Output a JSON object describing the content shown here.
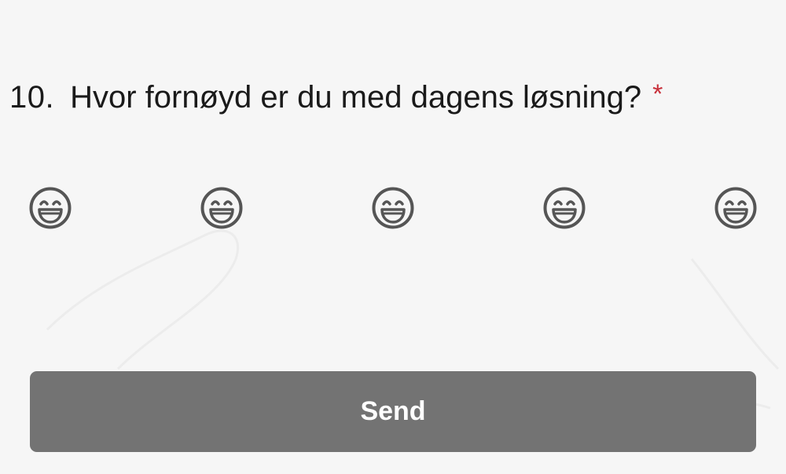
{
  "question": {
    "number": "10.",
    "text": "Hvor fornøyd er du med dagens løsning?",
    "required_marker": "*"
  },
  "rating": {
    "options": [
      {
        "icon": "grinning-face-icon"
      },
      {
        "icon": "grinning-face-icon"
      },
      {
        "icon": "grinning-face-icon"
      },
      {
        "icon": "grinning-face-icon"
      },
      {
        "icon": "grinning-face-icon"
      }
    ]
  },
  "actions": {
    "send_label": "Send"
  },
  "colors": {
    "background": "#f6f6f6",
    "text": "#1a1a1a",
    "required": "#c8303a",
    "icon": "#555555",
    "button": "#737373",
    "button_text": "#ffffff"
  }
}
